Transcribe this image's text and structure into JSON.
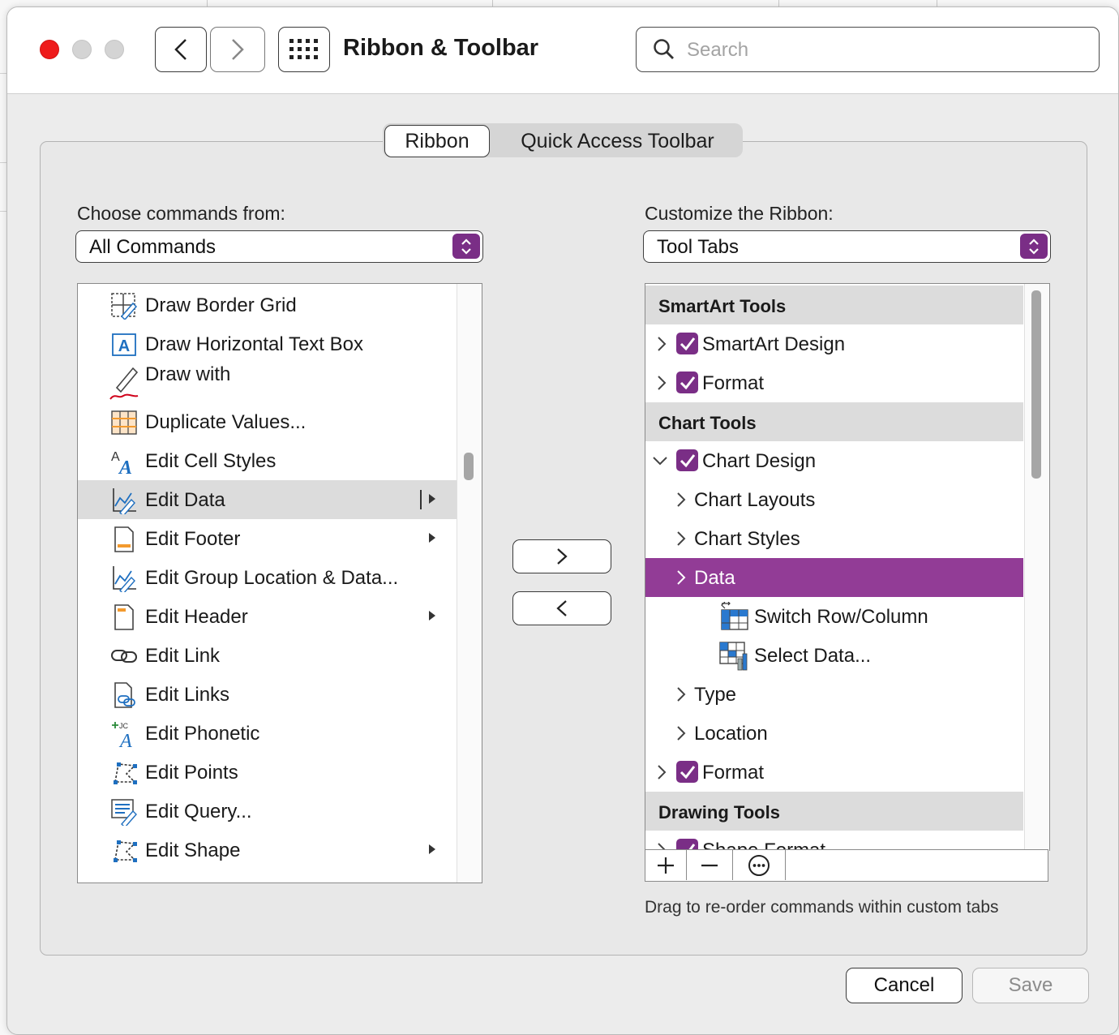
{
  "window": {
    "title": "Ribbon & Toolbar",
    "search_placeholder": "Search"
  },
  "tabs": {
    "ribbon": "Ribbon",
    "quick_access_toolbar": "Quick Access Toolbar",
    "selected": "Ribbon"
  },
  "left": {
    "label": "Choose commands from:",
    "dropdown_value": "All Commands",
    "commands": [
      {
        "label": "Draw Border Grid",
        "icon": "draw-border-grid-icon",
        "submenu": false
      },
      {
        "label": "Draw Horizontal Text Box",
        "icon": "text-box-icon",
        "submenu": false
      },
      {
        "label": "Draw with",
        "icon": "pen-icon",
        "submenu": false
      },
      {
        "label": "Duplicate Values...",
        "icon": "duplicate-values-icon",
        "submenu": false
      },
      {
        "label": "Edit Cell Styles",
        "icon": "cell-styles-icon",
        "submenu": false
      },
      {
        "label": "Edit Data",
        "icon": "edit-data-icon",
        "submenu": true,
        "selected": true
      },
      {
        "label": "Edit Footer",
        "icon": "footer-icon",
        "submenu": true
      },
      {
        "label": "Edit Group Location & Data...",
        "icon": "edit-group-icon",
        "submenu": false
      },
      {
        "label": "Edit Header",
        "icon": "header-icon",
        "submenu": true
      },
      {
        "label": "Edit Link",
        "icon": "link-icon",
        "submenu": false
      },
      {
        "label": "Edit Links",
        "icon": "links-icon",
        "submenu": false
      },
      {
        "label": "Edit Phonetic",
        "icon": "phonetic-icon",
        "submenu": false
      },
      {
        "label": "Edit Points",
        "icon": "points-icon",
        "submenu": false
      },
      {
        "label": "Edit Query...",
        "icon": "query-icon",
        "submenu": false
      },
      {
        "label": "Edit Shape",
        "icon": "shape-icon",
        "submenu": true
      }
    ]
  },
  "right": {
    "label": "Customize the Ribbon:",
    "dropdown_value": "Tool Tabs",
    "rows": [
      {
        "type": "header",
        "label": "SmartArt Tools"
      },
      {
        "type": "tab",
        "label": "SmartArt Design",
        "checked": true,
        "expanded": false
      },
      {
        "type": "tab",
        "label": "Format",
        "checked": true,
        "expanded": false
      },
      {
        "type": "header",
        "label": "Chart Tools"
      },
      {
        "type": "tab",
        "label": "Chart Design",
        "checked": true,
        "expanded": true
      },
      {
        "type": "group",
        "label": "Chart Layouts"
      },
      {
        "type": "group",
        "label": "Chart Styles"
      },
      {
        "type": "group",
        "label": "Data",
        "selected": true
      },
      {
        "type": "command",
        "label": "Switch Row/Column",
        "icon": "switch-row-column-icon"
      },
      {
        "type": "command",
        "label": "Select Data...",
        "icon": "select-data-icon"
      },
      {
        "type": "group",
        "label": "Type"
      },
      {
        "type": "group",
        "label": "Location"
      },
      {
        "type": "tab",
        "label": "Format",
        "checked": true,
        "expanded": false
      },
      {
        "type": "header",
        "label": "Drawing Tools"
      },
      {
        "type": "tab",
        "label": "Shape Format",
        "checked": true,
        "expanded": false
      }
    ],
    "hint": "Drag to re-order commands within custom tabs"
  },
  "buttons": {
    "cancel": "Cancel",
    "save": "Save"
  },
  "colors": {
    "accent": "#7a2e86",
    "selection": "#923c96",
    "close": "#ee1b1b"
  }
}
